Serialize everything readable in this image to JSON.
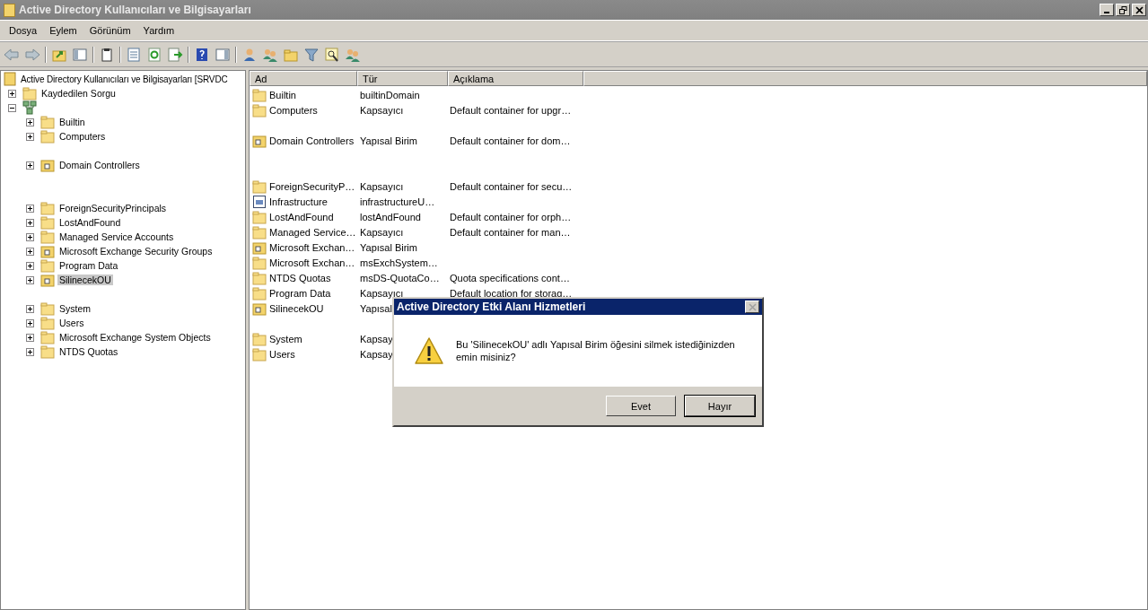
{
  "window": {
    "title": "Active Directory Kullanıcıları ve Bilgisayarları"
  },
  "menu": [
    "Dosya",
    "Eylem",
    "Görünüm",
    "Yardım"
  ],
  "tree": {
    "label": "Active Directory Kullanıcıları ve Bilgisayarları [SRVDC",
    "kind": "console",
    "children": [
      {
        "label": "Kaydedilen Sorgu",
        "kind": "folder",
        "expanded": false,
        "selected": false
      },
      {
        "kind": "domain",
        "expanded": true,
        "children": [
          {
            "kind": "folder",
            "label": "Builtin",
            "expanded": false,
            "selected": false
          },
          {
            "kind": "folder",
            "label": "Computers",
            "expanded": false,
            "selected": false
          },
          {
            "kind": "spacer"
          },
          {
            "kind": "ou",
            "label": "Domain Controllers",
            "expanded": false,
            "selected": false
          },
          {
            "kind": "spacer"
          },
          {
            "kind": "spacer"
          },
          {
            "kind": "folder",
            "label": "ForeignSecurityPrincipals",
            "expanded": false,
            "selected": false
          },
          {
            "kind": "folder",
            "label": "LostAndFound",
            "expanded": false,
            "selected": false
          },
          {
            "kind": "folder",
            "label": "Managed Service Accounts",
            "expanded": false,
            "selected": false
          },
          {
            "kind": "ou",
            "label": "Microsoft Exchange Security Groups",
            "expanded": false,
            "selected": false
          },
          {
            "kind": "folder",
            "label": "Program Data",
            "expanded": false,
            "selected": false
          },
          {
            "kind": "ou",
            "label": "SilinecekOU",
            "expanded": false,
            "selected": true
          },
          {
            "kind": "spacer"
          },
          {
            "kind": "folder",
            "label": "System",
            "expanded": false,
            "selected": false
          },
          {
            "kind": "folder",
            "label": "Users",
            "expanded": false,
            "selected": false
          },
          {
            "kind": "folder",
            "label": "Microsoft Exchange System Objects",
            "expanded": false,
            "selected": false
          },
          {
            "kind": "folder",
            "label": "NTDS Quotas",
            "expanded": false,
            "selected": false
          }
        ]
      }
    ]
  },
  "table": {
    "columns": [
      "Ad",
      "Tür",
      "Açıklama"
    ],
    "rows": [
      {
        "kind": "folder",
        "name": "Builtin",
        "type": "builtinDomain"
      },
      {
        "kind": "folder",
        "name": "Computers",
        "type": "Kapsayıcı",
        "description": "Default container for upgr…"
      },
      {
        "kind": "spacer"
      },
      {
        "kind": "ou",
        "name": "Domain Controllers",
        "type": "Yapısal Birim",
        "description": "Default container for dom…"
      },
      {
        "kind": "spacer"
      },
      {
        "kind": "spacer"
      },
      {
        "kind": "folder",
        "name": "ForeignSecurityP…",
        "type": "Kapsayıcı",
        "description": "Default container for secu…"
      },
      {
        "kind": "infra",
        "name": "Infrastructure",
        "type": "infrastructureU…"
      },
      {
        "kind": "folder",
        "name": "LostAndFound",
        "type": "lostAndFound",
        "description": "Default container for orph…"
      },
      {
        "kind": "folder",
        "name": "Managed Service…",
        "type": "Kapsayıcı",
        "description": "Default container for man…"
      },
      {
        "kind": "ou",
        "name": "Microsoft Exchan…",
        "type": "Yapısal Birim"
      },
      {
        "kind": "folder",
        "name": "Microsoft Exchan…",
        "type": "msExchSystem…"
      },
      {
        "kind": "folder",
        "name": "NTDS Quotas",
        "type": "msDS-QuotaCo…",
        "description": "Quota specifications cont…"
      },
      {
        "kind": "folder",
        "name": "Program Data",
        "type": "Kapsayıcı",
        "description": "Default location for storag…"
      },
      {
        "kind": "ou",
        "name": "SilinecekOU",
        "type": "Yapısal"
      },
      {
        "kind": "spacer"
      },
      {
        "kind": "folder",
        "name": "System",
        "type": "Kapsay"
      },
      {
        "kind": "folder",
        "name": "Users",
        "type": "Kapsay"
      }
    ]
  },
  "dialog": {
    "title": "Active Directory Etki Alanı Hizmetleri",
    "message": "Bu 'SilinecekOU' adlı Yapısal Birim öğesini silmek istediğinizden emin misiniz?",
    "buttons": [
      {
        "label": "Evet",
        "default": false
      },
      {
        "label": "Hayır",
        "default": true
      }
    ]
  }
}
